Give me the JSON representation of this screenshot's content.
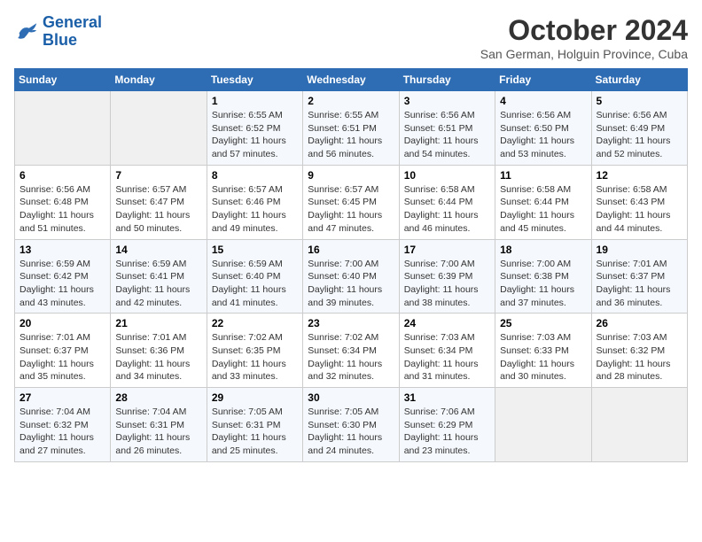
{
  "logo": {
    "line1": "General",
    "line2": "Blue"
  },
  "title": "October 2024",
  "subtitle": "San German, Holguin Province, Cuba",
  "days_of_week": [
    "Sunday",
    "Monday",
    "Tuesday",
    "Wednesday",
    "Thursday",
    "Friday",
    "Saturday"
  ],
  "weeks": [
    [
      null,
      null,
      {
        "day": 1,
        "sunrise": "6:55 AM",
        "sunset": "6:52 PM",
        "daylight": "11 hours and 57 minutes."
      },
      {
        "day": 2,
        "sunrise": "6:55 AM",
        "sunset": "6:51 PM",
        "daylight": "11 hours and 56 minutes."
      },
      {
        "day": 3,
        "sunrise": "6:56 AM",
        "sunset": "6:51 PM",
        "daylight": "11 hours and 54 minutes."
      },
      {
        "day": 4,
        "sunrise": "6:56 AM",
        "sunset": "6:50 PM",
        "daylight": "11 hours and 53 minutes."
      },
      {
        "day": 5,
        "sunrise": "6:56 AM",
        "sunset": "6:49 PM",
        "daylight": "11 hours and 52 minutes."
      }
    ],
    [
      {
        "day": 6,
        "sunrise": "6:56 AM",
        "sunset": "6:48 PM",
        "daylight": "11 hours and 51 minutes."
      },
      {
        "day": 7,
        "sunrise": "6:57 AM",
        "sunset": "6:47 PM",
        "daylight": "11 hours and 50 minutes."
      },
      {
        "day": 8,
        "sunrise": "6:57 AM",
        "sunset": "6:46 PM",
        "daylight": "11 hours and 49 minutes."
      },
      {
        "day": 9,
        "sunrise": "6:57 AM",
        "sunset": "6:45 PM",
        "daylight": "11 hours and 47 minutes."
      },
      {
        "day": 10,
        "sunrise": "6:58 AM",
        "sunset": "6:44 PM",
        "daylight": "11 hours and 46 minutes."
      },
      {
        "day": 11,
        "sunrise": "6:58 AM",
        "sunset": "6:44 PM",
        "daylight": "11 hours and 45 minutes."
      },
      {
        "day": 12,
        "sunrise": "6:58 AM",
        "sunset": "6:43 PM",
        "daylight": "11 hours and 44 minutes."
      }
    ],
    [
      {
        "day": 13,
        "sunrise": "6:59 AM",
        "sunset": "6:42 PM",
        "daylight": "11 hours and 43 minutes."
      },
      {
        "day": 14,
        "sunrise": "6:59 AM",
        "sunset": "6:41 PM",
        "daylight": "11 hours and 42 minutes."
      },
      {
        "day": 15,
        "sunrise": "6:59 AM",
        "sunset": "6:40 PM",
        "daylight": "11 hours and 41 minutes."
      },
      {
        "day": 16,
        "sunrise": "7:00 AM",
        "sunset": "6:40 PM",
        "daylight": "11 hours and 39 minutes."
      },
      {
        "day": 17,
        "sunrise": "7:00 AM",
        "sunset": "6:39 PM",
        "daylight": "11 hours and 38 minutes."
      },
      {
        "day": 18,
        "sunrise": "7:00 AM",
        "sunset": "6:38 PM",
        "daylight": "11 hours and 37 minutes."
      },
      {
        "day": 19,
        "sunrise": "7:01 AM",
        "sunset": "6:37 PM",
        "daylight": "11 hours and 36 minutes."
      }
    ],
    [
      {
        "day": 20,
        "sunrise": "7:01 AM",
        "sunset": "6:37 PM",
        "daylight": "11 hours and 35 minutes."
      },
      {
        "day": 21,
        "sunrise": "7:01 AM",
        "sunset": "6:36 PM",
        "daylight": "11 hours and 34 minutes."
      },
      {
        "day": 22,
        "sunrise": "7:02 AM",
        "sunset": "6:35 PM",
        "daylight": "11 hours and 33 minutes."
      },
      {
        "day": 23,
        "sunrise": "7:02 AM",
        "sunset": "6:34 PM",
        "daylight": "11 hours and 32 minutes."
      },
      {
        "day": 24,
        "sunrise": "7:03 AM",
        "sunset": "6:34 PM",
        "daylight": "11 hours and 31 minutes."
      },
      {
        "day": 25,
        "sunrise": "7:03 AM",
        "sunset": "6:33 PM",
        "daylight": "11 hours and 30 minutes."
      },
      {
        "day": 26,
        "sunrise": "7:03 AM",
        "sunset": "6:32 PM",
        "daylight": "11 hours and 28 minutes."
      }
    ],
    [
      {
        "day": 27,
        "sunrise": "7:04 AM",
        "sunset": "6:32 PM",
        "daylight": "11 hours and 27 minutes."
      },
      {
        "day": 28,
        "sunrise": "7:04 AM",
        "sunset": "6:31 PM",
        "daylight": "11 hours and 26 minutes."
      },
      {
        "day": 29,
        "sunrise": "7:05 AM",
        "sunset": "6:31 PM",
        "daylight": "11 hours and 25 minutes."
      },
      {
        "day": 30,
        "sunrise": "7:05 AM",
        "sunset": "6:30 PM",
        "daylight": "11 hours and 24 minutes."
      },
      {
        "day": 31,
        "sunrise": "7:06 AM",
        "sunset": "6:29 PM",
        "daylight": "11 hours and 23 minutes."
      },
      null,
      null
    ]
  ]
}
